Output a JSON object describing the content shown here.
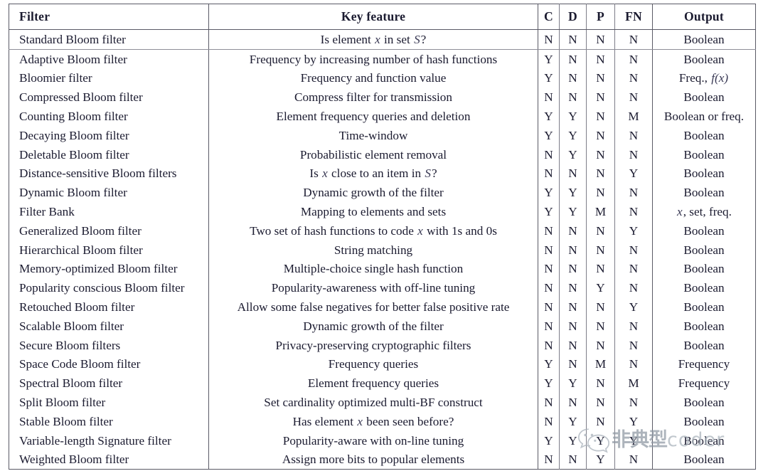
{
  "table": {
    "headers": {
      "filter": "Filter",
      "key_feature": "Key feature",
      "c": "C",
      "d": "D",
      "p": "P",
      "fn": "FN",
      "output": "Output"
    },
    "rows": [
      {
        "filter": "Standard Bloom filter",
        "key_feature_pre": "Is element ",
        "key_feature_var": "x",
        "key_feature_post": " in set ",
        "key_feature_var2": "S",
        "key_feature_post2": "?",
        "c": "N",
        "d": "N",
        "p": "N",
        "fn": "N",
        "output": "Boolean"
      },
      {
        "filter": "Adaptive Bloom filter",
        "key_feature": "Frequency by increasing number of hash functions",
        "c": "Y",
        "d": "N",
        "p": "N",
        "fn": "N",
        "output": "Boolean"
      },
      {
        "filter": "Bloomier filter",
        "key_feature": "Frequency and function value",
        "c": "Y",
        "d": "N",
        "p": "N",
        "fn": "N",
        "output_pre": "Freq., ",
        "output_var": "f(x)"
      },
      {
        "filter": "Compressed Bloom filter",
        "key_feature": "Compress filter for transmission",
        "c": "N",
        "d": "N",
        "p": "N",
        "fn": "N",
        "output": "Boolean"
      },
      {
        "filter": "Counting Bloom filter",
        "key_feature": "Element frequency queries and deletion",
        "c": "Y",
        "d": "Y",
        "p": "N",
        "fn": "M",
        "output": "Boolean or freq."
      },
      {
        "filter": "Decaying Bloom filter",
        "key_feature": "Time-window",
        "c": "Y",
        "d": "Y",
        "p": "N",
        "fn": "N",
        "output": "Boolean"
      },
      {
        "filter": "Deletable Bloom filter",
        "key_feature": "Probabilistic element removal",
        "c": "N",
        "d": "Y",
        "p": "N",
        "fn": "N",
        "output": "Boolean"
      },
      {
        "filter": "Distance-sensitive Bloom filters",
        "key_feature_pre": "Is ",
        "key_feature_var": "x",
        "key_feature_post": " close to an item in ",
        "key_feature_var2": "S",
        "key_feature_post2": "?",
        "c": "N",
        "d": "N",
        "p": "N",
        "fn": "Y",
        "output": "Boolean"
      },
      {
        "filter": "Dynamic Bloom filter",
        "key_feature": "Dynamic growth of the filter",
        "c": "Y",
        "d": "Y",
        "p": "N",
        "fn": "N",
        "output": "Boolean"
      },
      {
        "filter": "Filter Bank",
        "key_feature": "Mapping to elements and sets",
        "c": "Y",
        "d": "Y",
        "p": "M",
        "fn": "N",
        "output_var": "x",
        "output_post": ", set, freq."
      },
      {
        "filter": "Generalized Bloom filter",
        "key_feature_pre": "Two set of hash functions to code ",
        "key_feature_var": "x",
        "key_feature_post": " with 1s and 0s",
        "c": "N",
        "d": "N",
        "p": "N",
        "fn": "Y",
        "output": "Boolean"
      },
      {
        "filter": "Hierarchical Bloom filter",
        "key_feature": "String matching",
        "c": "N",
        "d": "N",
        "p": "N",
        "fn": "N",
        "output": "Boolean"
      },
      {
        "filter": "Memory-optimized Bloom filter",
        "key_feature": "Multiple-choice single hash function",
        "c": "N",
        "d": "N",
        "p": "N",
        "fn": "N",
        "output": "Boolean"
      },
      {
        "filter": "Popularity conscious Bloom filter",
        "key_feature": "Popularity-awareness with off-line tuning",
        "c": "N",
        "d": "N",
        "p": "Y",
        "fn": "N",
        "output": "Boolean"
      },
      {
        "filter": "Retouched Bloom filter",
        "key_feature": "Allow some false negatives for better false positive rate",
        "c": "N",
        "d": "N",
        "p": "N",
        "fn": "Y",
        "output": "Boolean"
      },
      {
        "filter": "Scalable Bloom filter",
        "key_feature": "Dynamic growth of the filter",
        "c": "N",
        "d": "N",
        "p": "N",
        "fn": "N",
        "output": "Boolean"
      },
      {
        "filter": "Secure Bloom filters",
        "key_feature": "Privacy-preserving cryptographic filters",
        "c": "N",
        "d": "N",
        "p": "N",
        "fn": "N",
        "output": "Boolean"
      },
      {
        "filter": "Space Code Bloom filter",
        "key_feature": "Frequency queries",
        "c": "Y",
        "d": "N",
        "p": "M",
        "fn": "N",
        "output": "Frequency"
      },
      {
        "filter": "Spectral Bloom filter",
        "key_feature": "Element frequency queries",
        "c": "Y",
        "d": "Y",
        "p": "N",
        "fn": "M",
        "output": "Frequency"
      },
      {
        "filter": "Split Bloom filter",
        "key_feature": "Set cardinality optimized multi-BF construct",
        "c": "N",
        "d": "N",
        "p": "N",
        "fn": "N",
        "output": "Boolean"
      },
      {
        "filter": "Stable Bloom filter",
        "key_feature_pre": "Has element ",
        "key_feature_var": "x",
        "key_feature_post": " been seen before?",
        "c": "N",
        "d": "Y",
        "p": "N",
        "fn": "Y",
        "output": "Boolean"
      },
      {
        "filter": "Variable-length Signature filter",
        "key_feature": "Popularity-aware with on-line tuning",
        "c": "Y",
        "d": "Y",
        "p": "Y",
        "fn": "Y",
        "output": "Boolean"
      },
      {
        "filter": "Weighted Bloom filter",
        "key_feature": "Assign more bits to popular elements",
        "c": "N",
        "d": "N",
        "p": "Y",
        "fn": "N",
        "output": "Boolean"
      }
    ]
  },
  "watermark": {
    "chinese": "非典型",
    "english": "coder"
  }
}
